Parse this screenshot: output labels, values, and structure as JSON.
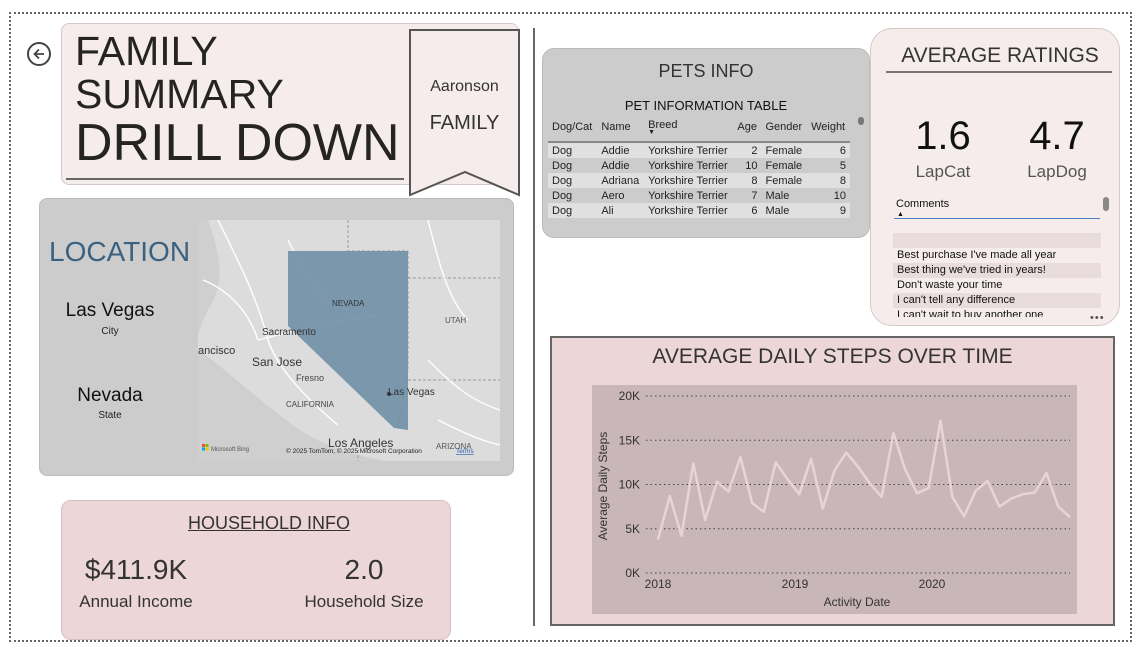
{
  "header": {
    "title_line1": "FAMILY",
    "title_line2": "SUMMARY",
    "title_line3": "DRILL DOWN",
    "family_name": "Aaronson",
    "family_label": "FAMILY",
    "back_icon": "back-arrow-icon"
  },
  "location": {
    "title": "LOCATION",
    "city": "Las Vegas",
    "city_label": "City",
    "state": "Nevada",
    "state_label": "State",
    "map": {
      "labels": [
        "NEVADA",
        "UTAH",
        "Sacramento",
        "ancisco",
        "San Jose",
        "Fresno",
        "CALIFORNIA",
        "Las Vegas",
        "Los Angeles",
        "ARIZONA"
      ],
      "attribution": "© 2025 TomTom, © 2025 Microsoft Corporation",
      "terms": "Terms",
      "brand": "Microsoft Bing",
      "highlight_color": "#6f8fa6"
    }
  },
  "household": {
    "title": "HOUSEHOLD INFO",
    "income_value": "$411.9K",
    "income_label": "Annual Income",
    "size_value": "2.0",
    "size_label": "Household Size"
  },
  "pets": {
    "title": "PETS INFO",
    "table_title": "PET INFORMATION TABLE",
    "columns": [
      "Dog/Cat",
      "Name",
      "Breed",
      "Age",
      "Gender",
      "Weight"
    ],
    "rows": [
      [
        "Dog",
        "Addie",
        "Yorkshire Terrier",
        "2",
        "Female",
        "6"
      ],
      [
        "Dog",
        "Addie",
        "Yorkshire Terrier",
        "10",
        "Female",
        "5"
      ],
      [
        "Dog",
        "Adriana",
        "Yorkshire Terrier",
        "8",
        "Female",
        "8"
      ],
      [
        "Dog",
        "Aero",
        "Yorkshire Terrier",
        "7",
        "Male",
        "10"
      ],
      [
        "Dog",
        "Ali",
        "Yorkshire Terrier",
        "6",
        "Male",
        "9"
      ]
    ]
  },
  "ratings": {
    "title": "AVERAGE RATINGS",
    "lapcat_value": "1.6",
    "lapcat_label": "LapCat",
    "lapdog_value": "4.7",
    "lapdog_label": "LapDog",
    "comments_header": "Comments",
    "comments": [
      "",
      "Best purchase I've made all year",
      "Best thing we've tried in years!",
      "Don't waste your time",
      "I can't tell any difference",
      "I can't wait to buy another one"
    ],
    "more": "•••"
  },
  "chart_data": {
    "type": "line",
    "title": "AVERAGE DAILY STEPS OVER TIME",
    "xlabel": "Activity Date",
    "ylabel": "Average Daily Steps",
    "y_ticks": [
      "0K",
      "5K",
      "10K",
      "15K",
      "20K"
    ],
    "x_ticks": [
      "2018",
      "2019",
      "2020"
    ],
    "ylim": [
      0,
      20000
    ],
    "grid": true,
    "line_color": "#ead3d5",
    "plot_bg": "#c9b6b8",
    "series": [
      {
        "values": [
          3800,
          8700,
          4200,
          12400,
          6000,
          10300,
          9200,
          13100,
          7900,
          6900,
          12500,
          10600,
          8900,
          12900,
          7300,
          11600,
          13600,
          12000,
          10100,
          8600,
          15800,
          11700,
          9000,
          9600,
          17200,
          8600,
          6400,
          9300,
          10400,
          7500,
          8400,
          8900,
          9100,
          11300,
          7500,
          6300
        ]
      }
    ]
  }
}
